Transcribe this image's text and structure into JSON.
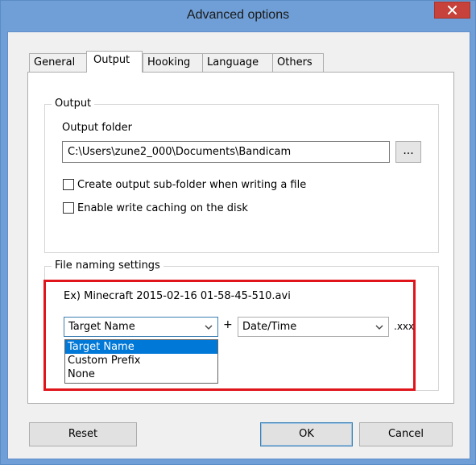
{
  "window": {
    "title": "Advanced options"
  },
  "tabs": [
    {
      "label": "General",
      "active": false
    },
    {
      "label": "Output",
      "active": true
    },
    {
      "label": "Hooking",
      "active": false
    },
    {
      "label": "Language",
      "active": false
    },
    {
      "label": "Others",
      "active": false
    }
  ],
  "output": {
    "group_label": "Output",
    "folder_label": "Output folder",
    "folder_value": "C:\\Users\\zune2_000\\Documents\\Bandicam",
    "browse_label": "...",
    "checkboxes": [
      {
        "label": "Create output sub-folder when writing a file",
        "checked": false
      },
      {
        "label": "Enable write caching on the disk",
        "checked": false
      }
    ]
  },
  "naming": {
    "group_label": "File naming settings",
    "example": "Ex) Minecraft 2015-02-16 01-58-45-510.avi",
    "prefix_selected": "Target Name",
    "plus": "+",
    "suffix_selected": "Date/Time",
    "extension": ".xxx",
    "prefix_options": [
      "Target Name",
      "Custom Prefix",
      "None"
    ],
    "prefix_highlighted_index": 0
  },
  "buttons": {
    "reset": "Reset",
    "ok": "OK",
    "cancel": "Cancel"
  },
  "colors": {
    "title_bar": "#6f9fd6",
    "close_button": "#c7423a",
    "highlight_box": "#e0151b",
    "selection": "#0078d7"
  }
}
